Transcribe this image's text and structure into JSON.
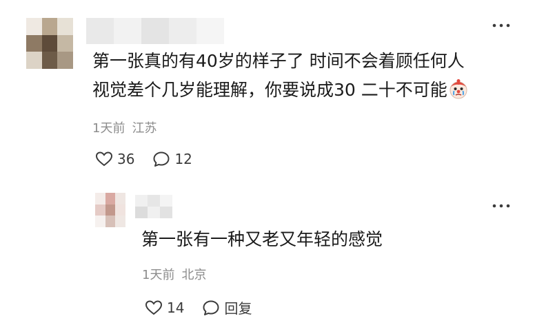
{
  "comments": [
    {
      "lines": [
        "第一张真的有40岁的样子了 时间不会着顾任何人",
        "视觉差个几岁能理解，你要说成30 二十不可能"
      ],
      "emoji": "clown-crying-icon",
      "time": "1天前",
      "location": "江苏",
      "likes": "36",
      "replies": "12",
      "avatar_colors": [
        "#efe9e2",
        "#b9a78f",
        "#e7e1d6",
        "#8e7a64",
        "#5e4b3a",
        "#c5b8a4",
        "#dcd3c6",
        "#6d5b48",
        "#a89884"
      ],
      "name_colors": [
        "#e9e9e9",
        "#f2f2f2",
        "#e4e4e4",
        "#ededed",
        "#f5f5f5"
      ]
    }
  ],
  "reply": {
    "text": "第一张有一种又老又年轻的感觉",
    "time": "1天前",
    "location": "北京",
    "likes": "14",
    "reply_label": "回复",
    "avatar_colors": [
      "#f4ece9",
      "#d9a9a2",
      "#efe6e2",
      "#e5cbc6",
      "#c2988c",
      "#f0e3df",
      "#f6f1ef",
      "#d7c0b8",
      "#efe7e3"
    ],
    "name_colors": [
      "#f0f0f0",
      "#e6e6e6",
      "#f4f4f4",
      "#dcdcdc",
      "#f0f0f0",
      "#e2e2e2"
    ]
  },
  "colors": {
    "meta_text": "#8c8c8c",
    "body_text": "#1a1a1a",
    "icon": "#3b3b3b"
  },
  "icons": {
    "more": "more-dots-icon",
    "like": "heart-outline-icon",
    "reply": "comment-bubble-icon"
  }
}
